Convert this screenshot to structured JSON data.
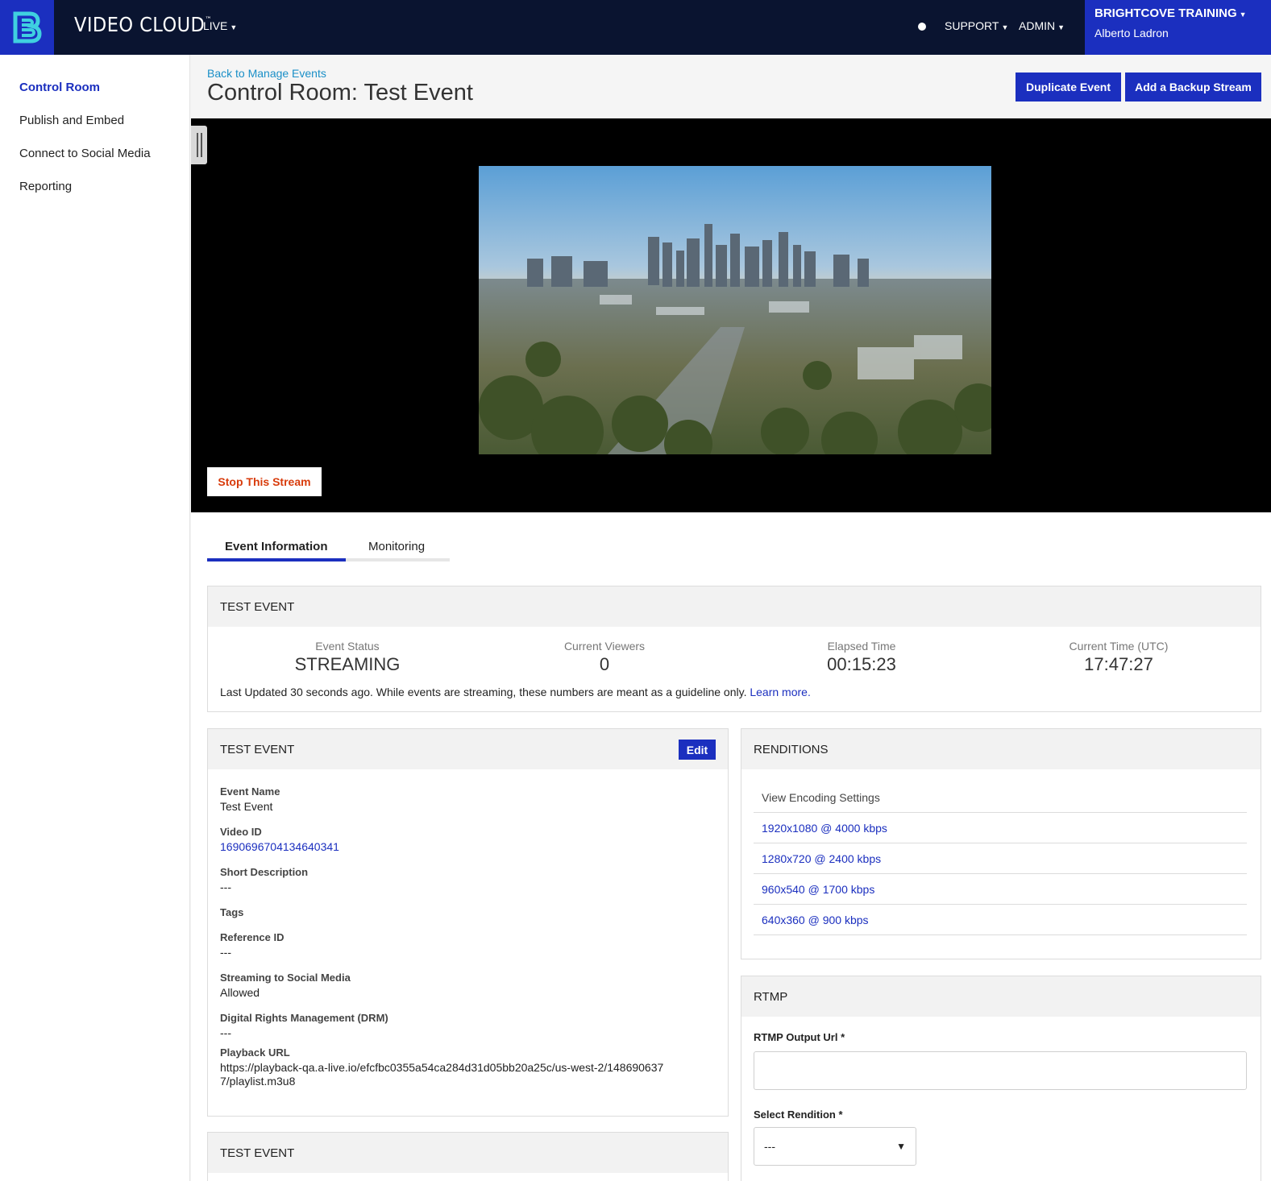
{
  "topbar": {
    "brand": "VIDEO CLOUD",
    "brand_tm": "™",
    "live_menu": "LIVE",
    "support_menu": "SUPPORT",
    "admin_menu": "ADMIN",
    "account_name": "BRIGHTCOVE TRAINING",
    "user_name": "Alberto Ladron"
  },
  "sidebar": {
    "items": [
      {
        "label": "Control Room",
        "active": true
      },
      {
        "label": "Publish and Embed"
      },
      {
        "label": "Connect to Social Media"
      },
      {
        "label": "Reporting"
      }
    ]
  },
  "header": {
    "back_link": "Back to Manage Events",
    "title": "Control Room: Test Event",
    "duplicate_button": "Duplicate Event",
    "backup_button": "Add a Backup Stream"
  },
  "player": {
    "stop_button": "Stop This Stream"
  },
  "tabs": [
    {
      "label": "Event Information",
      "active": true
    },
    {
      "label": "Monitoring"
    }
  ],
  "status_panel": {
    "title": "TEST EVENT",
    "stats": [
      {
        "label": "Event Status",
        "value": "STREAMING"
      },
      {
        "label": "Current Viewers",
        "value": "0"
      },
      {
        "label": "Elapsed Time",
        "value": "00:15:23"
      },
      {
        "label": "Current Time (UTC)",
        "value": "17:47:27"
      }
    ],
    "note": "Last Updated 30 seconds ago. While events are streaming, these numbers are meant as a guideline only.",
    "learn_more": "Learn more."
  },
  "details_panel": {
    "title": "TEST EVENT",
    "edit_button": "Edit",
    "fields": [
      {
        "label": "Event Name",
        "value": "Test Event"
      },
      {
        "label": "Video ID",
        "value": "1690696704134640341"
      },
      {
        "label": "Short Description",
        "value": "---"
      },
      {
        "label": "Tags",
        "value": ""
      },
      {
        "label": "Reference ID",
        "value": "---"
      },
      {
        "label": "Streaming to Social Media",
        "value": "Allowed"
      },
      {
        "label": "Digital Rights Management (DRM)",
        "value": "---"
      },
      {
        "label": "Playback URL",
        "value": "https://playback-qa.a-live.io/efcfbc0355a54ca284d31d05bb20a25c/us-west-2/1486906377/playlist.m3u8"
      }
    ]
  },
  "bottom_panel": {
    "title": "TEST EVENT"
  },
  "renditions_panel": {
    "title": "RENDITIONS",
    "view_settings": "View Encoding Settings",
    "items": [
      "1920x1080 @ 4000 kbps",
      "1280x720 @ 2400 kbps",
      "960x540 @ 1700 kbps",
      "640x360 @ 900 kbps"
    ]
  },
  "rtmp_panel": {
    "title": "RTMP",
    "output_url_label": "RTMP Output Url *",
    "output_url_value": "",
    "rendition_label": "Select Rendition *",
    "rendition_value": "---"
  },
  "colors": {
    "navy": "#0a1430",
    "brand_blue": "#1b2fbf",
    "link_teal": "#1a8fc7",
    "stop_red": "#d83b0b"
  }
}
